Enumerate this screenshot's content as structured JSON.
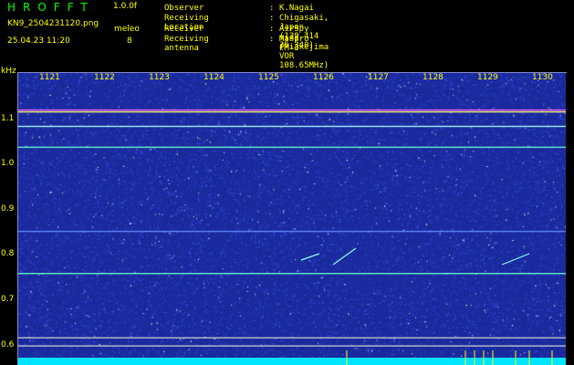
{
  "header": {
    "app_title": "HROFFT",
    "version": "1.0.0f",
    "file_name": "KN9_2504231120.png",
    "timestamp": "25.04.23 11:20",
    "mode_label": "meleo",
    "mode_value": "8"
  },
  "info": [
    {
      "key": "Observer",
      "value": "K.Nagai"
    },
    {
      "key": "Receiving Location",
      "value": "Chigasaki, Japan (139.414 35.340)"
    },
    {
      "key": "Receiver",
      "value": "AirSpy mini (Miakejima VOR 108.65MHz)"
    },
    {
      "key": "Receiving antenna",
      "value": "Maspro FM-3"
    }
  ],
  "info_separator": ":",
  "spectrogram": {
    "unit_label": "kHz",
    "freq_ticks": [
      "1121",
      "1122",
      "1123",
      "1124",
      "1125",
      "1126",
      "1127",
      "1128",
      "1129",
      "1130"
    ],
    "y_ticks": [
      {
        "label": "1.1",
        "value": 1.1
      },
      {
        "label": "1.0",
        "value": 1.0
      },
      {
        "label": "0.9",
        "value": 0.9
      },
      {
        "label": "0.8",
        "value": 0.8
      },
      {
        "label": "0.7",
        "value": 0.7
      },
      {
        "label": "0.6",
        "value": 0.6
      }
    ],
    "y_range": [
      0.555,
      1.2
    ],
    "bands": [
      {
        "value": 1.118,
        "color": "#ff66ff"
      },
      {
        "value": 1.114,
        "color": "#ffff66"
      },
      {
        "value": 1.082,
        "color": "#aaffff"
      },
      {
        "value": 1.036,
        "color": "#66ffcc"
      },
      {
        "value": 0.85,
        "color": "#6688ff"
      },
      {
        "value": 0.757,
        "color": "#66ffcc"
      },
      {
        "value": 0.615,
        "color": "#cccccc"
      },
      {
        "value": 0.597,
        "color": "#cccccc"
      }
    ],
    "colors": {
      "background": "#1a2a9c",
      "noise_low": "#4060ff",
      "noise_high": "#ffffff",
      "baseline": "#00e5ff",
      "marker": "#ffff00"
    }
  }
}
